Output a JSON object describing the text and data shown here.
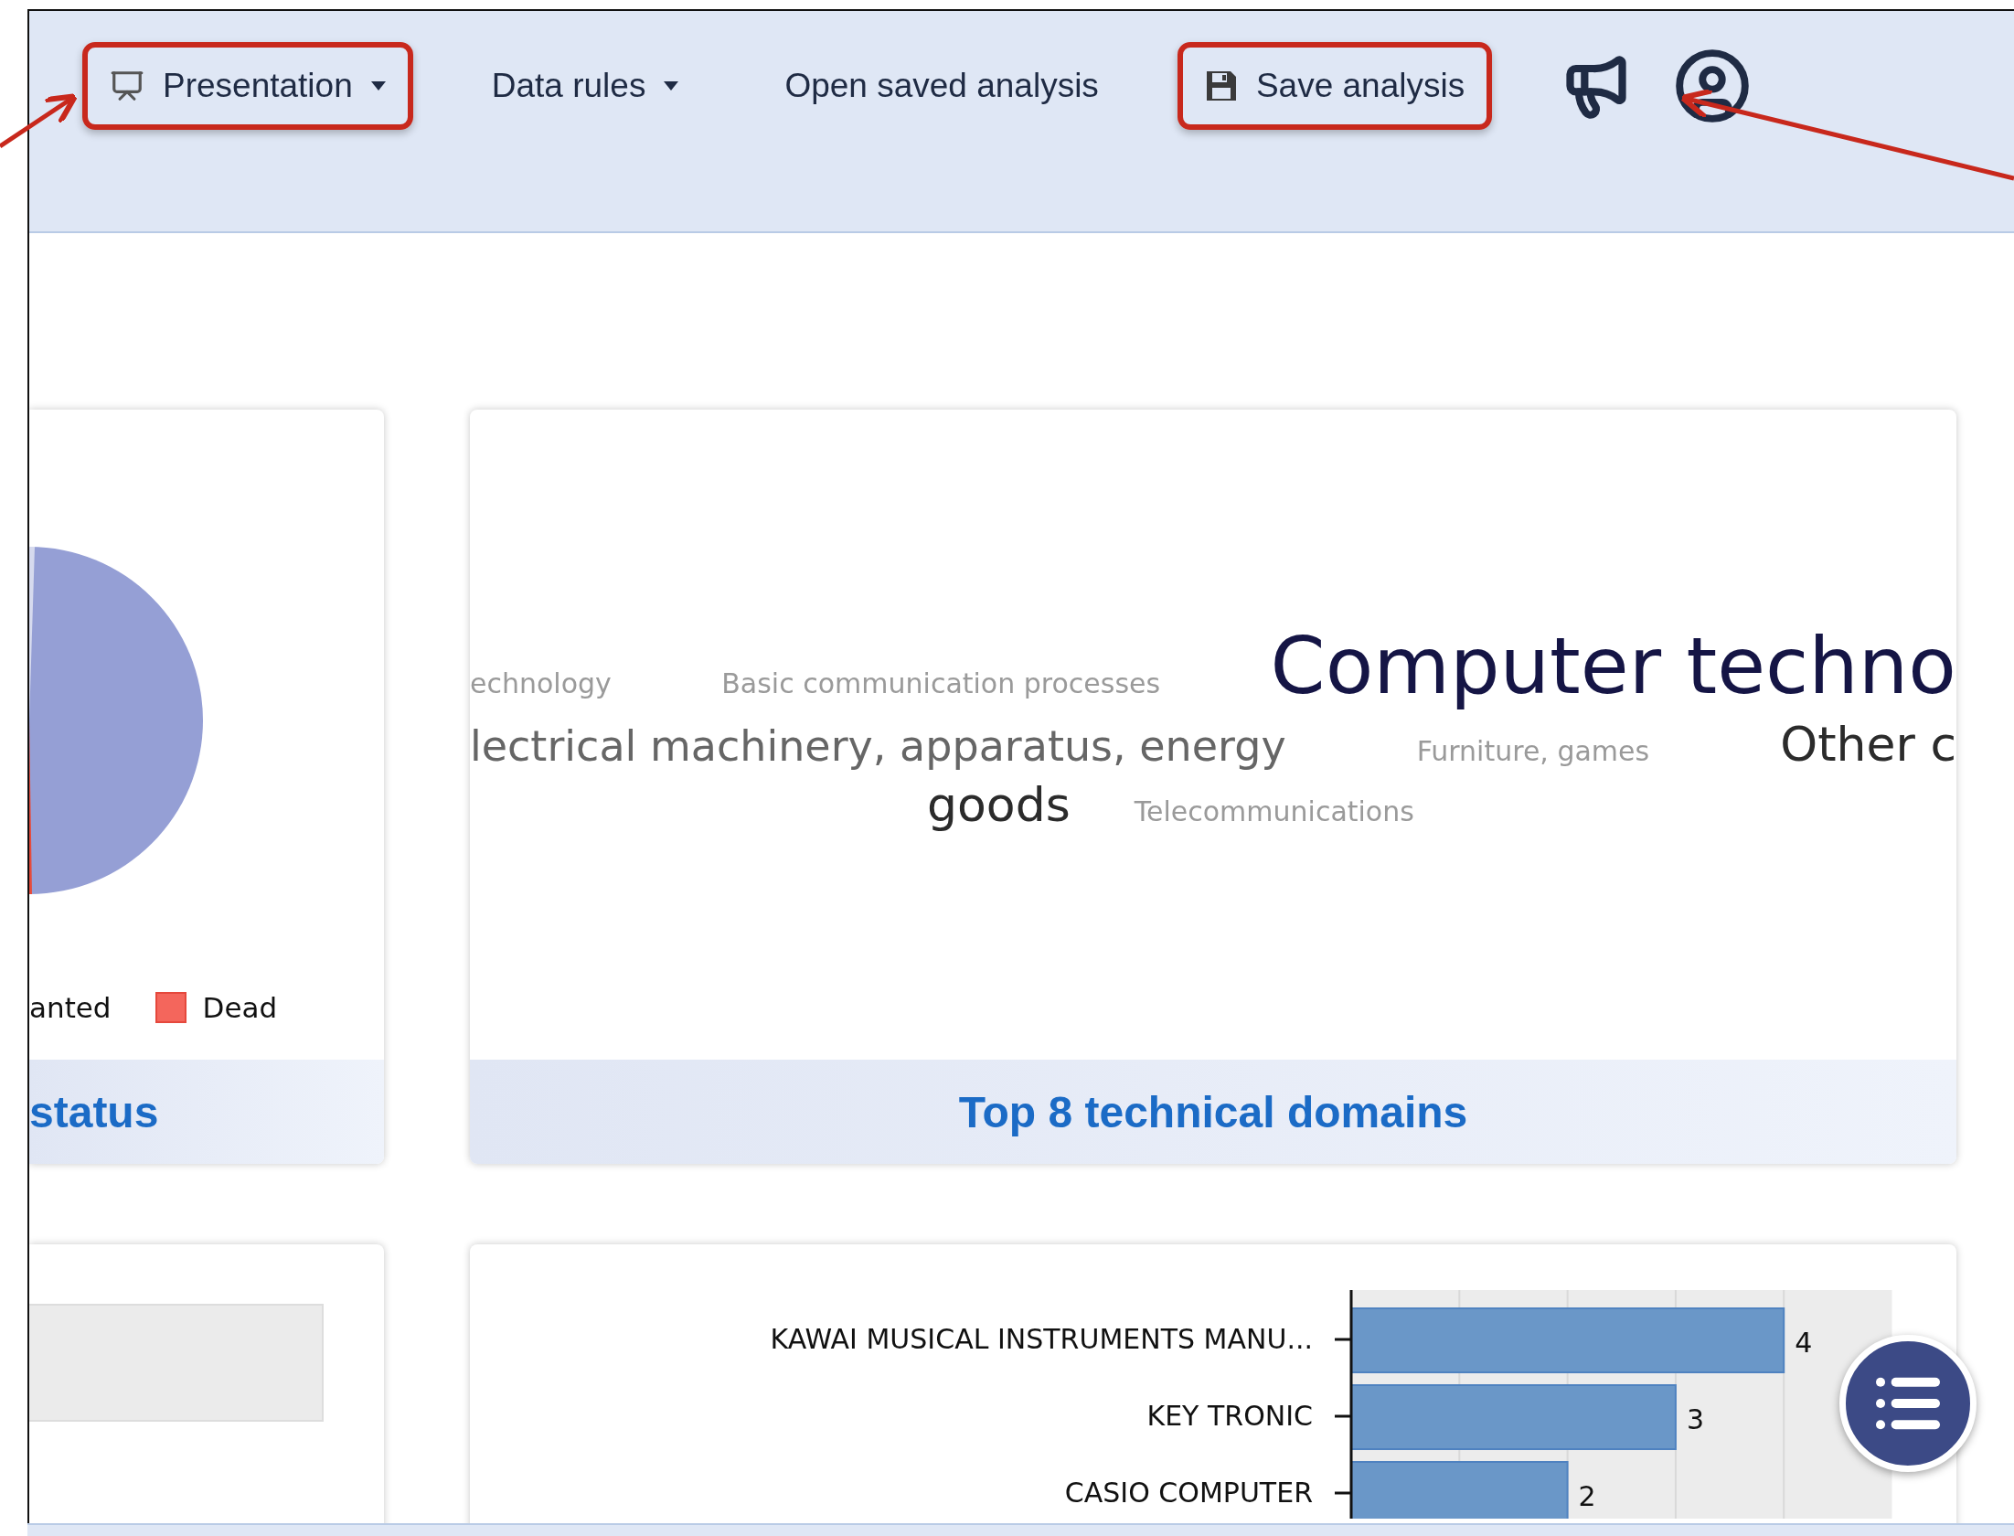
{
  "toolbar": {
    "menus": [
      {
        "kind": "presentation",
        "label": "Presentation",
        "highlighted": true
      },
      {
        "kind": "dropdown",
        "label": "Data rules",
        "highlighted": false
      },
      {
        "kind": "link",
        "label": "Open saved analysis",
        "highlighted": false
      },
      {
        "kind": "save",
        "label": "Save analysis",
        "highlighted": true
      }
    ]
  },
  "status_card": {
    "legend": [
      {
        "label": "anted"
      },
      {
        "label": "Dead",
        "color": "#f4665c"
      }
    ],
    "title": "status"
  },
  "domains_card": {
    "lines": [
      {
        "terms": [
          {
            "text": "echnology",
            "kind": "small"
          },
          {
            "text": "Basic communication processes",
            "kind": "small"
          },
          {
            "text": "Computer techno",
            "kind": "huge"
          }
        ]
      },
      {
        "terms": [
          {
            "text": "lectrical machinery, apparatus, energy",
            "kind": "medium"
          },
          {
            "text": "Furniture, games",
            "kind": "small"
          },
          {
            "text": "Other c",
            "kind": "large"
          }
        ]
      },
      {
        "terms": [
          {
            "text": "goods",
            "kind": "large"
          },
          {
            "text": "Telecommunications",
            "kind": "small"
          }
        ]
      }
    ],
    "title": "Top 8 technical domains"
  },
  "applicants_card": {
    "chart_data": {
      "type": "bar",
      "orientation": "horizontal",
      "categories": [
        "KAWAI MUSICAL INSTRUMENTS MANU...",
        "KEY TRONIC",
        "CASIO COMPUTER"
      ],
      "values": [
        4,
        3,
        2
      ],
      "data_labels": true
    }
  }
}
